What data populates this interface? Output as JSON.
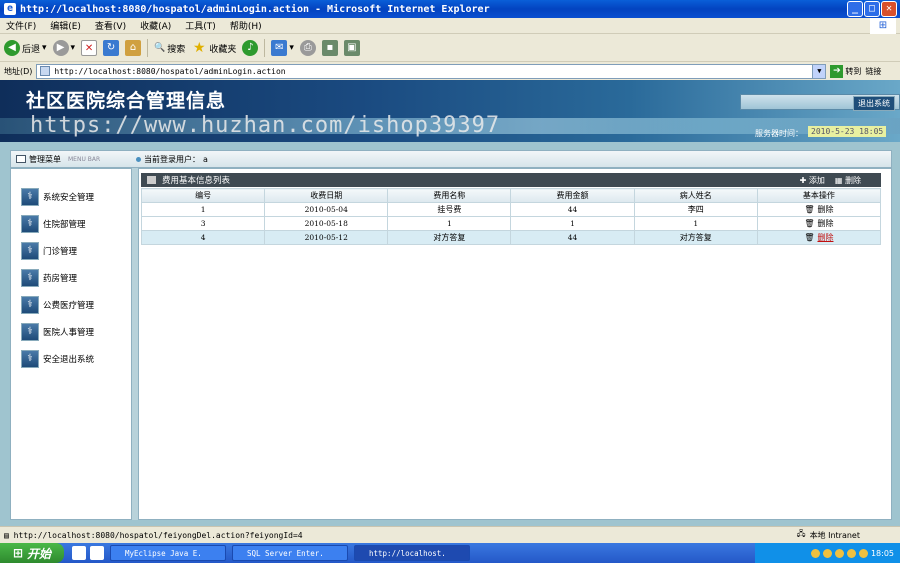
{
  "window": {
    "title": "http://localhost:8080/hospatol/adminLogin.action - Microsoft Internet Explorer",
    "min": "_",
    "max": "□",
    "close": "✕"
  },
  "menu": [
    "文件(F)",
    "编辑(E)",
    "查看(V)",
    "收藏(A)",
    "工具(T)",
    "帮助(H)"
  ],
  "toolbar": {
    "back": "后退",
    "search": "搜索",
    "favorites": "收藏夹"
  },
  "address": {
    "label": "地址(D)",
    "url": "http://localhost:8080/hospatol/adminLogin.action",
    "go": "转到",
    "links": "链接"
  },
  "banner": {
    "title": "社区医院综合管理信息",
    "watermark": "https://www.huzhan.com/ishop39397",
    "logout": "退出系统",
    "server_time_label": "服务器时间：",
    "server_time": "2010-5-23 18:05"
  },
  "subheader": {
    "menu_label": "管理菜单",
    "menu_small": "MENU BAR",
    "current_user_label": "当前登录用户：",
    "current_user": "a"
  },
  "sidebar": {
    "items": [
      "系统安全管理",
      "住院部管理",
      "门诊管理",
      "药房管理",
      "公费医疗管理",
      "医院人事管理",
      "安全退出系统"
    ]
  },
  "list": {
    "title": "费用基本信息列表",
    "add": "添加",
    "delete": "删除",
    "columns": [
      "编号",
      "收费日期",
      "费用名称",
      "费用金额",
      "病人姓名",
      "基本操作"
    ],
    "rows": [
      [
        "1",
        "2010-05-04",
        "挂号费",
        "44",
        "李四"
      ],
      [
        "3",
        "2010-05-18",
        "1",
        "1",
        "1"
      ],
      [
        "4",
        "2010-05-12",
        "对方答复",
        "44",
        "对方答复"
      ]
    ],
    "row_action": "删除"
  },
  "status": {
    "url": "http://localhost:8080/hospatol/feiyongDel.action?feiyongId=4",
    "zone": "本地 Intranet"
  },
  "taskbar": {
    "start": "开始",
    "tasks": [
      "MyEclipse Java E.",
      "SQL Server Enter.",
      "http://localhost."
    ],
    "clock": "18:05"
  }
}
